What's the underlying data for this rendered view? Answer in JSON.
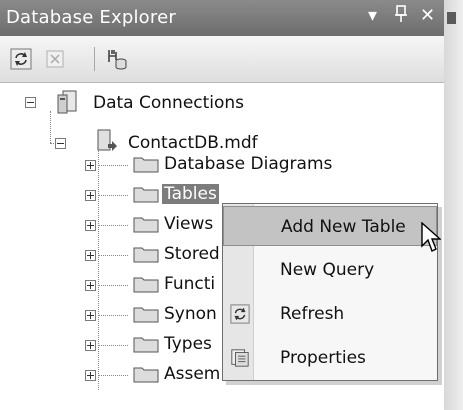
{
  "window": {
    "title": "Database Explorer",
    "controls": {
      "dropdown": "▾",
      "pin": "ᵖ",
      "close": "✕"
    }
  },
  "toolbar": {
    "buttons": [
      {
        "name": "refresh",
        "icon": "refresh-icon"
      },
      {
        "name": "stop-refresh",
        "icon": "stop-icon",
        "enabled": false
      },
      {
        "name": "connect-to-database",
        "icon": "connect-database-icon"
      }
    ]
  },
  "tree": {
    "root": {
      "label": "Data Connections",
      "icon": "data-connections-icon",
      "expanded": true
    },
    "database": {
      "label": "ContactDB.mdf",
      "icon": "database-icon",
      "expanded": true
    },
    "folders": [
      {
        "label": "Database Diagrams"
      },
      {
        "label": "Tables",
        "selected": true
      },
      {
        "label": "Views"
      },
      {
        "label": "Stored"
      },
      {
        "label": "Functi"
      },
      {
        "label": "Synon"
      },
      {
        "label": "Types"
      },
      {
        "label": "Assem"
      }
    ]
  },
  "context_menu": {
    "items": [
      {
        "label": "Add New Table",
        "icon": "",
        "highlighted": true
      },
      {
        "label": "New Query",
        "icon": ""
      },
      {
        "label": "Refresh",
        "icon": "refresh-icon"
      },
      {
        "label": "Properties",
        "icon": "properties-icon"
      }
    ]
  },
  "colors": {
    "titlebar": "#7a7a7a",
    "selection": "#7c7c7c",
    "menu_highlight": "#c3c3c3"
  }
}
